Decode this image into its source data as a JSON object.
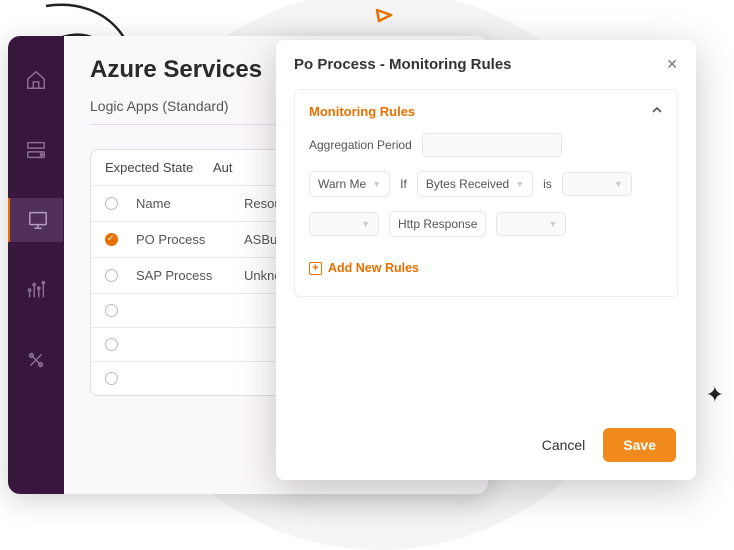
{
  "page": {
    "title": "Azure Services",
    "subtitle": "Logic Apps (Standard)"
  },
  "grid": {
    "headers": {
      "state": "Expected State",
      "aut": "Aut"
    },
    "subheaders": {
      "name": "Name",
      "resource": "Resource"
    },
    "rows": [
      {
        "name": "PO Process",
        "resource": "ASBuild",
        "selected": true
      },
      {
        "name": "SAP Process",
        "resource": "Unknow",
        "selected": false
      }
    ]
  },
  "modal": {
    "title": "Po Process - Monitoring Rules",
    "section_title": "Monitoring Rules",
    "agg_label": "Aggregation Period",
    "rule": {
      "warn": "Warn Me",
      "if": "If",
      "metric": "Bytes Received",
      "is": "is",
      "resp": "Http Response"
    },
    "add_label": "Add New Rules",
    "cancel": "Cancel",
    "save": "Save"
  }
}
